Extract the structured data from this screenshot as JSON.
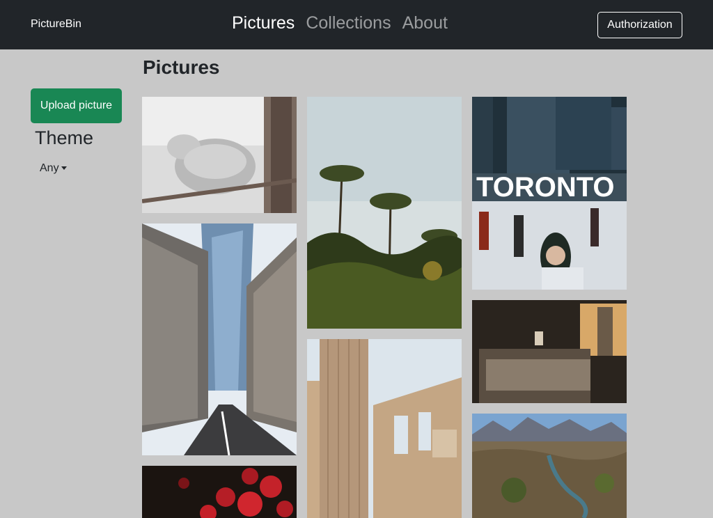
{
  "navbar": {
    "brand": "PictureBin",
    "links": [
      "Pictures",
      "Collections",
      "About"
    ],
    "auth_button": "Authorization"
  },
  "sidebar": {
    "upload_button": "Upload picture",
    "theme_heading": "Theme",
    "theme_dropdown": "Any"
  },
  "main": {
    "title": "Pictures",
    "pictures": [
      {
        "subject": "snow-covered cat"
      },
      {
        "subject": "palm trees"
      },
      {
        "subject": "Toronto sign ice rink"
      },
      {
        "subject": "city street with skyscraper"
      },
      {
        "subject": "ancient greek ruins"
      },
      {
        "subject": "hotel room with city view"
      },
      {
        "subject": "red flowers"
      },
      {
        "subject": "mountain valley with river"
      }
    ]
  },
  "colors": {
    "navbar_bg": "#212529",
    "page_bg": "#c8c8c8",
    "upload_button_bg": "#198754"
  }
}
